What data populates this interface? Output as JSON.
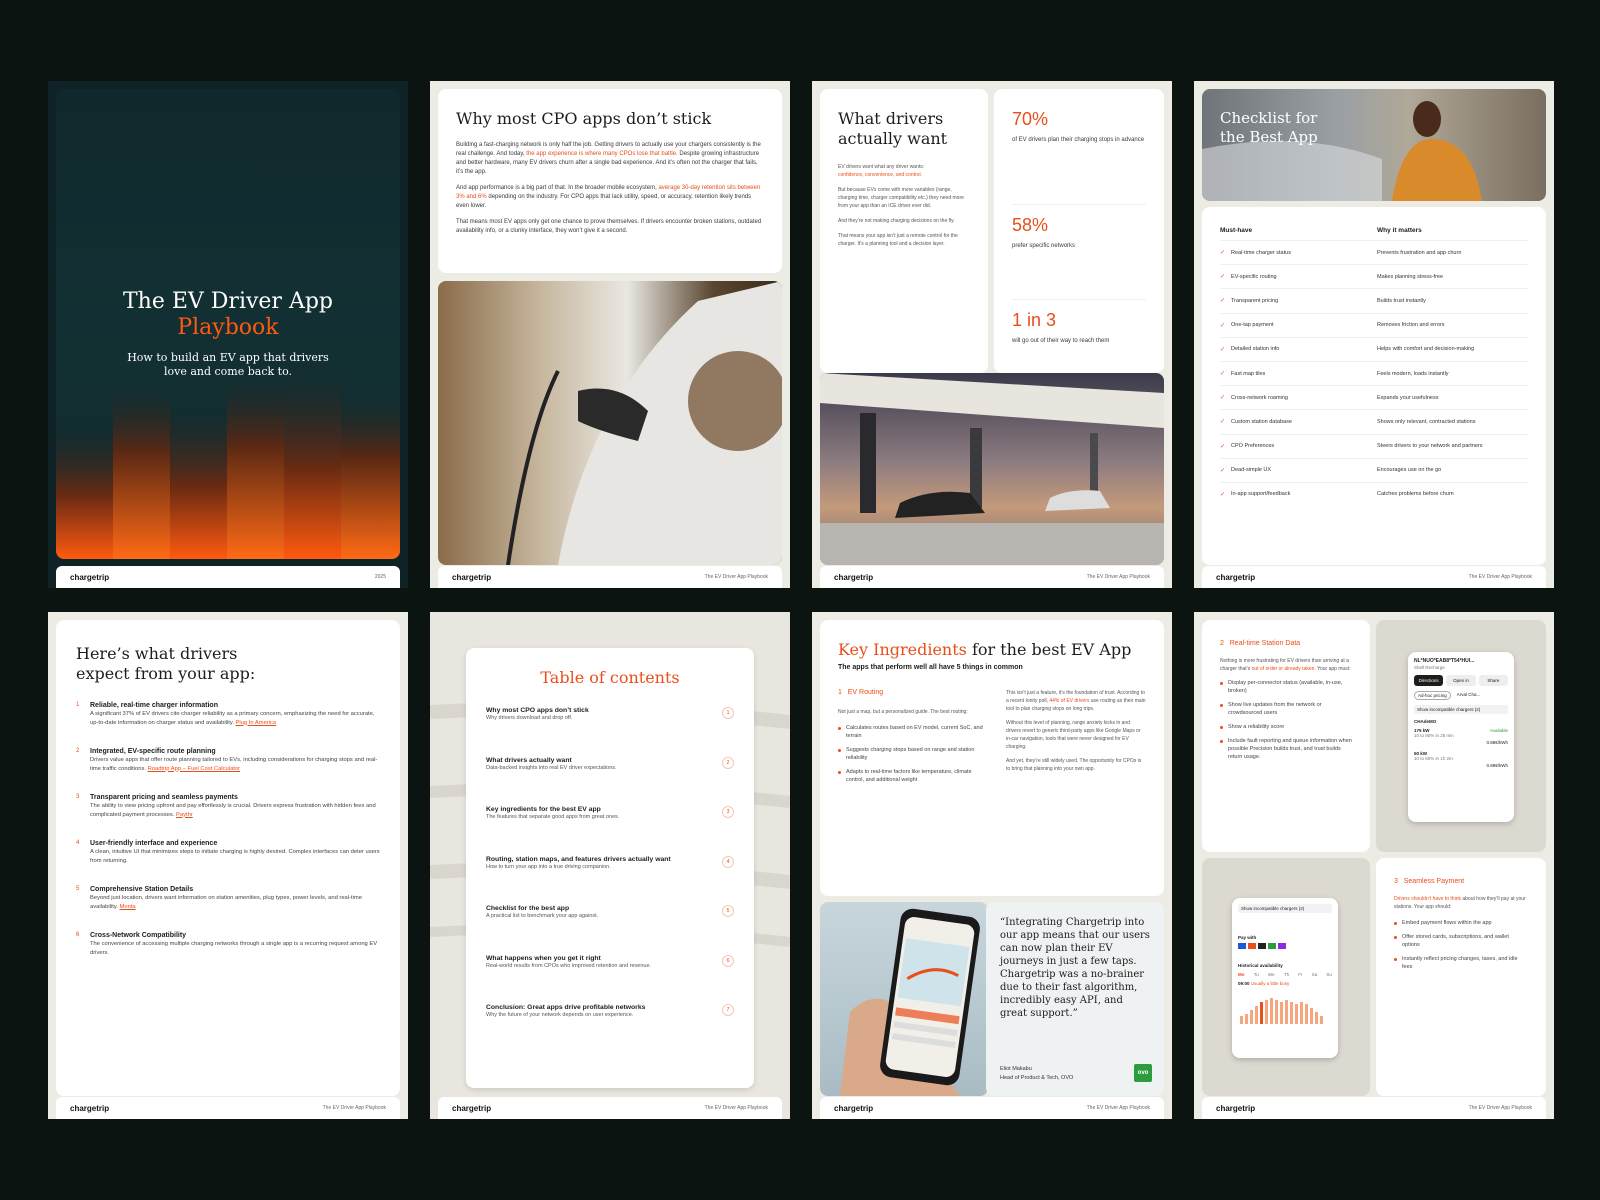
{
  "cover": {
    "title_line1": "The EV Driver App",
    "title_line2": "Playbook",
    "subtitle": "How to build an EV app that drivers love and come back to.",
    "year": "2025"
  },
  "brand": {
    "logo": "chargetrip",
    "footer_text": "The EV Driver App Playbook"
  },
  "p2": {
    "title": "Why most CPO apps don’t stick",
    "para1_a": "Building a fast-charging network is only half the job. Getting drivers to actually use your chargers consistently is the real challenge. And today, ",
    "para1_hl": "the app experience is where many CPOs lose that battle.",
    "para1_b": " Despite growing infrastructure and better hardware, many EV drivers churn after a single bad experience. And it’s often not the charger that fails, it’s the app.",
    "para2_a": "And app performance is a big part of that. In the broader mobile ecosystem, ",
    "para2_hl": "average 30-day retention sits between 3% and 6%",
    "para2_b": " depending on the industry. For CPO apps that lack utility, speed, or accuracy, retention likely trends even lower.",
    "para3": "That means most EV apps only get one chance to prove themselves. If drivers encounter broken stations, outdated availability info, or a clunky interface, they won’t give it a second."
  },
  "p3": {
    "title": "What drivers actually want",
    "intro": "EV drivers want what any driver wants:",
    "intro_hl": "confidence, convenience, and control.",
    "para2": "But because EVs come with more variables (range, charging time, charger compatibility etc.) they need more from your app than an ICE driver ever did.",
    "para3": "And they’re not making charging decisions on the fly.",
    "para4": "That means your app isn’t just a remote control for the charger. It’s a planning tool and a decision layer.",
    "stats": [
      {
        "value": "70%",
        "label": "of EV drivers plan their charging stops in advance"
      },
      {
        "value": "58%",
        "label": "prefer specific networks"
      },
      {
        "value": "1 in 3",
        "label": "will go out of their way to reach them"
      }
    ]
  },
  "p4": {
    "title": "Checklist for the Best App",
    "col1": "Must-have",
    "col2": "Why it matters",
    "rows": [
      [
        "Real-time charger status",
        "Prevents frustration and app churn"
      ],
      [
        "EV-specific routing",
        "Makes planning stress-free"
      ],
      [
        "Transparent pricing",
        "Builds trust instantly"
      ],
      [
        "One-tap payment",
        "Removes friction and errors"
      ],
      [
        "Detailed station info",
        "Helps with comfort and decision-making"
      ],
      [
        "Fast map tiles",
        "Feels modern, loads instantly"
      ],
      [
        "Cross-network roaming",
        "Expands your usefulness"
      ],
      [
        "Custom station database",
        "Shows only relevant, contracted stations"
      ],
      [
        "CPO Preferences",
        "Steers drivers to your network and partners"
      ],
      [
        "Dead-simple UX",
        "Encourages use on the go"
      ],
      [
        "In-app support/feedback",
        "Catches problems before churn"
      ]
    ]
  },
  "p5": {
    "title": "Here’s what drivers expect from your app:",
    "items": [
      {
        "n": "1",
        "title": "Reliable, real-time charger information",
        "body": "A significant 37% of EV drivers cite charger reliability as a primary concern, emphasizing the need for accurate, up-to-date information on charger status and availability. ",
        "link": "Plug In America"
      },
      {
        "n": "2",
        "title": "Integrated, EV-specific route planning",
        "body": "Drivers value apps that offer route planning tailored to EVs, including considerations for charging stops and real-time traffic conditions. ",
        "link": "Roadtrip App – Fuel Cost Calculator"
      },
      {
        "n": "3",
        "title": "Transparent pricing and seamless payments",
        "body": "The ability to view pricing upfront and pay effortlessly is crucial. Drivers express frustration with hidden fees and complicated payment processes. ",
        "link": "Paythr"
      },
      {
        "n": "4",
        "title": "User-friendly interface and experience",
        "body": "A clean, intuitive UI that minimizes steps to initiate charging is highly desired. Complex interfaces can deter users from returning.",
        "link": ""
      },
      {
        "n": "5",
        "title": "Comprehensive Station Details",
        "body": "Beyond just location, drivers want information on station amenities, plug types, power levels, and real-time availability. ",
        "link": "Monta"
      },
      {
        "n": "6",
        "title": "Cross-Network Compatibility",
        "body": "The convenience of accessing multiple charging networks through a single app is a recurring request among EV drivers.",
        "link": ""
      }
    ]
  },
  "p6": {
    "title": "Table of contents",
    "items": [
      {
        "t": "Why most CPO apps don’t stick",
        "s": "Why drivers download and drop off.",
        "n": "1"
      },
      {
        "t": "What drivers actually want",
        "s": "Data-backed insights into real EV driver expectations.",
        "n": "2"
      },
      {
        "t": "Key ingredients for the best EV app",
        "s": "The features that separate good apps from great ones.",
        "n": "3"
      },
      {
        "t": "Routing, station maps, and features drivers actually want",
        "s": "How to turn your app into a true driving companion.",
        "n": "4"
      },
      {
        "t": "Checklist for the best app",
        "s": "A practical list to benchmark your app against.",
        "n": "5"
      },
      {
        "t": "What happens when you get it right",
        "s": "Real-world results from CPOs who improved retention and revenue.",
        "n": "6"
      },
      {
        "t": "Conclusion: Great apps drive profitable networks",
        "s": "Why the future of your network depends on user experience.",
        "n": "7"
      }
    ]
  },
  "p7": {
    "title_hl": "Key Ingredients",
    "title_rest": " for the best EV App",
    "subtitle": "The apps that perform well all have 5 things in common",
    "sec_n": "1",
    "sec_t": "EV Routing",
    "intro": "Not just a map, but a personalized guide. The best routing:",
    "bullets": [
      "Calculates routes based on EV model, current SoC, and terrain",
      "Suggests charging stops based on range and station reliability",
      "Adapts to real-time factors like temperature, climate control, and additional weight"
    ],
    "right1_a": "This isn’t just a feature, it’s the foundation of trust. According to a recent Ionity poll, ",
    "right1_hl": "44% of EV drivers",
    "right1_b": " use routing as their main tool to plan charging stops on long trips.",
    "right2": "Without this level of planning, range anxiety kicks in and drivers revert to generic third-party apps like Google Maps or in-car navigation, tools that were never designed for EV charging.",
    "right3": "And yet, they’re still widely used. The opportunity for CPOs is to bring that planning into your own app.",
    "quote": "“Integrating Chargetrip into our app means that our users can now plan their EV journeys in just a few taps. Chargetrip was a no-brainer due to their fast algorithm, incredibly easy API, and great support.”",
    "author": "Eliot Makabu",
    "role": "Head of Product & Tech, OVO",
    "ovo": "ovo"
  },
  "p8": {
    "sec2_n": "2",
    "sec2_t": "Real-time Station Data",
    "sec2_intro_a": "Nothing is more frustrating for EV drivers than arriving at a charger that’s ",
    "sec2_intro_hl": "out of order or already taken.",
    "sec2_intro_b": " Your app must:",
    "sec2_bullets": [
      "Display per-connector status (available, in-use, broken)",
      "Show live updates from the network or crowdsourced users",
      "Show a reliability score",
      "Include fault reporting and queue information when possible Precision builds trust, and trust builds return usage."
    ],
    "sec3_n": "3",
    "sec3_t": "Seamless Payment",
    "sec3_intro_hl": "Drivers shouldn’t have to think",
    "sec3_intro_b": " about how they’ll pay at your stations. Your app should:",
    "sec3_bullets": [
      "Embed payment flows within the app",
      "Offer stored cards, subscriptions, and wallet options",
      "Instantly reflect pricing changes, taxes, and idle fees"
    ],
    "phone1": {
      "station": "NL*NUO*EAB8*T54*HUI...",
      "sub": "Shell Recharge",
      "btn1": "Directions",
      "btn2": "Open in",
      "btn3": "Share",
      "chip1": "Ad-hoc pricing",
      "chip2": "Arval Cha...",
      "filter": "Show incompatible chargers (2)",
      "conn": "CHAdeMO",
      "p1": "175 kW",
      "p1s": "10 to 80% in 25 min",
      "p1a": "Available",
      "p1price": "0.88€/kWh",
      "p2": "50 kW",
      "p2s": "10 to 80% in 1h 2m",
      "p2price": "0.88€/kWh"
    },
    "phone2": {
      "filter": "Show incompatible chargers (2)",
      "pay": "Pay with",
      "hist": "Historical availability",
      "days": [
        "Mo",
        "Tu",
        "We",
        "Th",
        "Fr",
        "Sa",
        "Su"
      ],
      "time": "09:00",
      "time_note": "Usually a little busy"
    }
  },
  "colors": {
    "accent": "#e94e1b",
    "bg": "#0c1412",
    "cover": "#10282a"
  }
}
